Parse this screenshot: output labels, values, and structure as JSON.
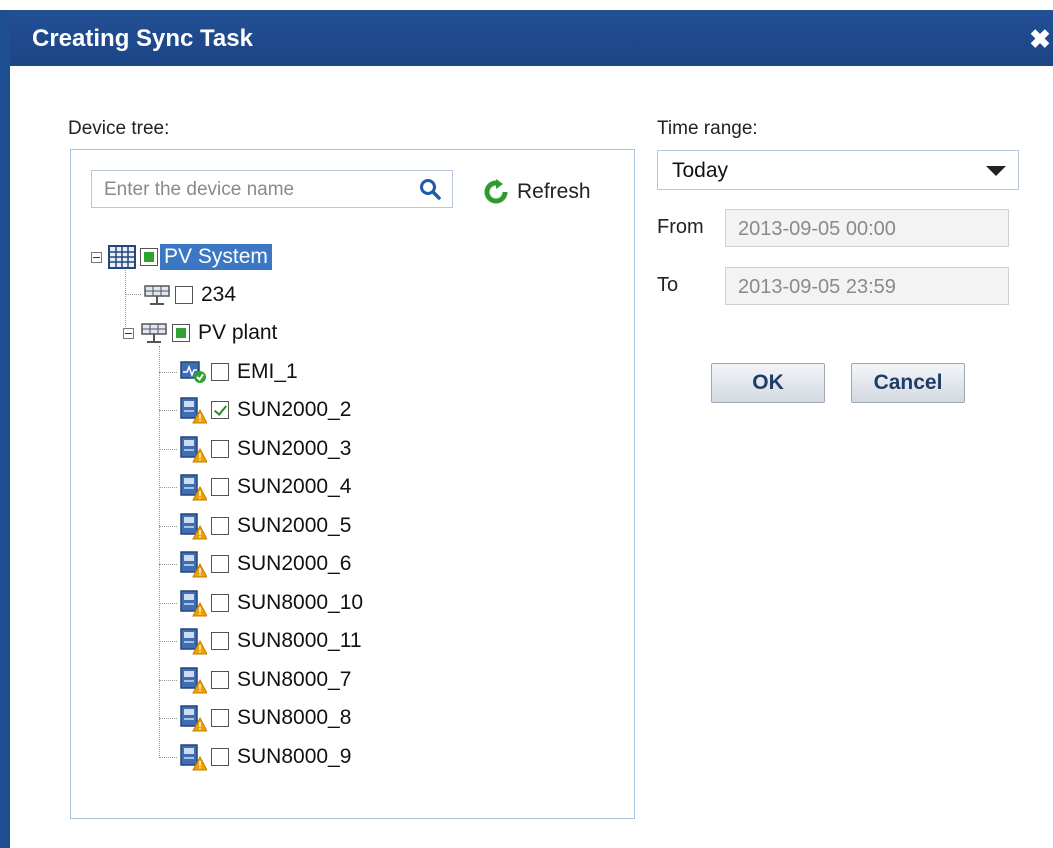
{
  "dialog": {
    "title": "Creating Sync Task"
  },
  "device_tree": {
    "label": "Device tree:",
    "search_placeholder": "Enter the device name",
    "refresh_label": "Refresh",
    "root": {
      "label": "PV System",
      "state": "partial",
      "selected": true
    },
    "children": [
      {
        "label": "234",
        "state": "unchecked"
      },
      {
        "label": "PV plant",
        "state": "partial"
      }
    ],
    "devices": [
      {
        "label": "EMI_1",
        "state": "unchecked",
        "type": "emi"
      },
      {
        "label": "SUN2000_2",
        "state": "checked",
        "type": "inverter"
      },
      {
        "label": "SUN2000_3",
        "state": "unchecked",
        "type": "inverter"
      },
      {
        "label": "SUN2000_4",
        "state": "unchecked",
        "type": "inverter"
      },
      {
        "label": "SUN2000_5",
        "state": "unchecked",
        "type": "inverter"
      },
      {
        "label": "SUN2000_6",
        "state": "unchecked",
        "type": "inverter"
      },
      {
        "label": "SUN8000_10",
        "state": "unchecked",
        "type": "inverter"
      },
      {
        "label": "SUN8000_11",
        "state": "unchecked",
        "type": "inverter"
      },
      {
        "label": "SUN8000_7",
        "state": "unchecked",
        "type": "inverter"
      },
      {
        "label": "SUN8000_8",
        "state": "unchecked",
        "type": "inverter"
      },
      {
        "label": "SUN8000_9",
        "state": "unchecked",
        "type": "inverter"
      }
    ]
  },
  "time_range": {
    "label": "Time range:",
    "selected": "Today",
    "from_label": "From",
    "from_value": "2013-09-05 00:00",
    "to_label": "To",
    "to_value": "2013-09-05 23:59"
  },
  "buttons": {
    "ok": "OK",
    "cancel": "Cancel"
  },
  "colors": {
    "title_bar": "#1f4f93",
    "selection": "#3b77c2",
    "check_green": "#2fa32f",
    "warning": "#f0a000"
  }
}
